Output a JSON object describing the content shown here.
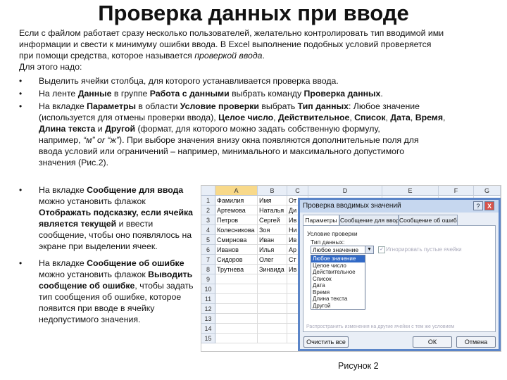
{
  "title": "Проверка данных при вводе",
  "intro": {
    "line1": "Если с файлом работает сразу несколько пользователей, желательно контролировать тип вводимой ими",
    "line2": "информации и свести к минимуму ошибки ввода. В Excel выполнение подобных условий проверяется",
    "line3_pre": "при помощи средства, которое называется ",
    "line3_italic": "проверкой ввода",
    "line3_post": ".",
    "line4": "Для этого надо:"
  },
  "bullet_char": "•",
  "bullet1": "Выделить ячейки столбца, для которого устанавливается проверка ввода.",
  "bullet2": {
    "t1": "На ленте ",
    "b1": "Данные",
    "t2": " в группе ",
    "b2": "Работа с данными",
    "t3": " выбрать команду ",
    "b3": "Проверка данных",
    "t4": "."
  },
  "bullet3": {
    "l1_t1": "На вкладке ",
    "l1_b1": "Параметры",
    "l1_t2": " в области ",
    "l1_b2": "Условие проверки",
    "l1_t3": " выбрать ",
    "l1_b3": "Тип данных",
    "l1_t4": ": Любое значение",
    "l2_t1": "(используется для отмены проверки ввода), ",
    "l2_b1": "Целое число",
    "l2_t2": ", ",
    "l2_b2": "Действительное",
    "l2_t3": ", ",
    "l2_b3": "Список",
    "l2_t4": ", ",
    "l2_b4": "Дата",
    "l2_t5": ", ",
    "l2_b5": "Время",
    "l2_t6": ",",
    "l3_b1": "Длина текста",
    "l3_t1": " и ",
    "l3_b2": "Другой",
    "l3_t2": " (формат, для которого можно задать собственную формулу,",
    "l4_t1": "например, ",
    "l4_i1": "“м” or “ж”",
    "l4_t2": "). При выборе значения внизу окна появляются дополнительные поля для",
    "l5": "ввода условий или ограничений – например, минимального и максимального допустимого",
    "l6": "значения (Рис.2)."
  },
  "bullet4": {
    "l1_t1": "На вкладке ",
    "l1_b1": "Сообщение для ввода",
    "l2": "можно установить флажок",
    "l3_b1": "Отображать подсказку, если ячейка",
    "l4_b1": "является текущей",
    "l4_t1": " и ввести",
    "l5": "сообщение, чтобы оно появлялось на",
    "l6": "экране при выделении ячеек."
  },
  "bullet5": {
    "l1_t1": "На вкладке ",
    "l1_b1": "Сообщение об ошибке",
    "l2_t1": "можно установить флажок ",
    "l2_b1": "Выводить",
    "l3_b1": "сообщение об ошибке",
    "l3_t1": ", чтобы задать",
    "l4": "тип сообщения об ошибке, которое",
    "l5": "появится при вводе в ячейку",
    "l6": "недопустимого значения."
  },
  "spreadsheet": {
    "columns": [
      "A",
      "B",
      "C",
      "D",
      "E",
      "F",
      "G"
    ],
    "rows": [
      "1",
      "2",
      "3",
      "4",
      "5",
      "6",
      "7",
      "8",
      "9",
      "10",
      "11",
      "12",
      "13",
      "14",
      "15"
    ],
    "col_a": [
      "Фамилия",
      "Артемова",
      "Петров",
      "Колесникова",
      "Смирнова",
      "Иванов",
      "Сидоров",
      "Трутнева"
    ],
    "col_b": [
      "Имя",
      "Наталья",
      "Сергей",
      "Зоя",
      "Иван",
      "Илья",
      "Олег",
      "Зинаида"
    ],
    "col_c": [
      "От",
      "Ди",
      "Ив",
      "Ни",
      "Ив",
      "Ар",
      "Ст",
      "Ив"
    ]
  },
  "dialog": {
    "title": "Проверка вводимых значений",
    "help": "?",
    "close": "X",
    "tabs": [
      "Параметры",
      "Сообщение для ввода",
      "Сообщение об ошибке"
    ],
    "group_label": "Условие проверки",
    "type_label": "Тип данных:",
    "selected": "Любое значение",
    "checkbox_label": "Игнорировать пустые ячейки",
    "options": [
      "Любое значение",
      "Целое число",
      "Действительное",
      "Список",
      "Дата",
      "Время",
      "Длина текста",
      "Другой"
    ],
    "apply_all": "Распространить изменения на другие ячейки с тем же условием",
    "clear_all": "Очистить все",
    "ok": "ОК",
    "cancel": "Отмена"
  },
  "caption": "Рисунок 2"
}
